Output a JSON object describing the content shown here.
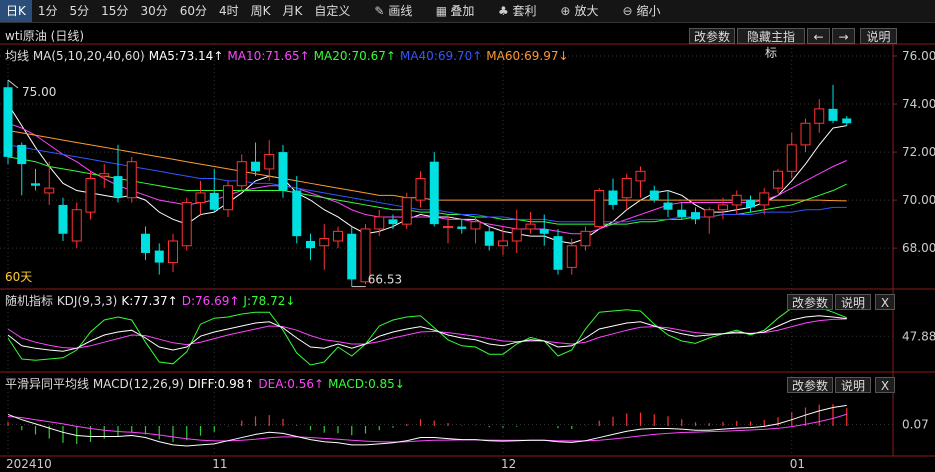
{
  "toolbar": {
    "items": [
      "日K",
      "1分",
      "5分",
      "15分",
      "30分",
      "60分",
      "4时",
      "周K",
      "月K",
      "自定义",
      "画线",
      "叠加",
      "套利",
      "放大",
      "缩小"
    ],
    "active": 0
  },
  "panel_buttons": {
    "main": [
      "改参数",
      "隐藏主指标",
      "←",
      "→",
      "说明"
    ],
    "kdj": [
      "改参数",
      "说明",
      "X"
    ],
    "macd": [
      "改参数",
      "说明",
      "X"
    ]
  },
  "main_title": "wti原油 (日线)",
  "ma_legend": {
    "prefix": "均线 MA(5,10,20,40,60)",
    "items": [
      {
        "text": "MA5:73.14↑",
        "color": "#ffffff"
      },
      {
        "text": "MA10:71.65↑",
        "color": "#ff44ff"
      },
      {
        "text": "MA20:70.67↑",
        "color": "#33ff33"
      },
      {
        "text": "MA40:69.70↑",
        "color": "#3355ff"
      },
      {
        "text": "MA60:69.97↓",
        "color": "#ff9933"
      }
    ]
  },
  "kdj_legend": {
    "prefix": "随机指标 KDJ(9,3,3)",
    "items": [
      {
        "text": "K:77.37↑",
        "color": "#ffffff"
      },
      {
        "text": "D:76.69↑",
        "color": "#ff44ff"
      },
      {
        "text": "J:78.72↓",
        "color": "#33ff33"
      }
    ]
  },
  "macd_legend": {
    "prefix": "平滑异同平均线 MACD(12,26,9)",
    "items": [
      {
        "text": "DIFF:0.98↑",
        "color": "#ffffff"
      },
      {
        "text": "DEA:0.56↑",
        "color": "#ff44ff"
      },
      {
        "text": "MACD:0.85↓",
        "color": "#33ff33"
      }
    ]
  },
  "annotations": {
    "high": "75.00",
    "low": "66.53",
    "period": "60天"
  },
  "chart_data": {
    "type": "candlestick",
    "title": "wti原油 (日线)",
    "x_ticks": [
      {
        "label": "202410",
        "index": 0
      },
      {
        "label": "11",
        "index": 15
      },
      {
        "label": "12",
        "index": 36
      },
      {
        "label": "01",
        "index": 57
      }
    ],
    "y_ticks": [
      68.0,
      70.0,
      72.0,
      74.0,
      76.0
    ],
    "ylim": [
      66.3,
      76.5
    ],
    "candles": [
      [
        74.7,
        75.0,
        71.5,
        71.8
      ],
      [
        72.3,
        72.4,
        70.2,
        71.5
      ],
      [
        70.7,
        71.3,
        70.4,
        70.6
      ],
      [
        70.3,
        71.6,
        69.8,
        70.5
      ],
      [
        69.8,
        70.1,
        68.3,
        68.6
      ],
      [
        68.3,
        69.9,
        68.0,
        69.6
      ],
      [
        69.5,
        71.2,
        69.2,
        70.9
      ],
      [
        71.0,
        71.5,
        70.5,
        71.1
      ],
      [
        71.0,
        72.3,
        69.9,
        70.1
      ],
      [
        70.1,
        71.8,
        69.9,
        71.6
      ],
      [
        68.6,
        68.9,
        67.5,
        67.8
      ],
      [
        67.9,
        68.2,
        66.9,
        67.4
      ],
      [
        67.4,
        68.6,
        67.0,
        68.3
      ],
      [
        68.1,
        70.1,
        67.9,
        69.9
      ],
      [
        69.9,
        70.8,
        69.4,
        70.3
      ],
      [
        70.3,
        71.3,
        69.5,
        69.6
      ],
      [
        69.6,
        70.8,
        69.3,
        70.6
      ],
      [
        70.6,
        71.9,
        70.4,
        71.6
      ],
      [
        71.6,
        72.4,
        71.0,
        71.2
      ],
      [
        71.3,
        72.5,
        70.8,
        71.9
      ],
      [
        72.0,
        72.3,
        70.1,
        70.4
      ],
      [
        70.4,
        71.0,
        68.2,
        68.5
      ],
      [
        68.3,
        68.6,
        67.5,
        68.0
      ],
      [
        68.1,
        69.0,
        67.1,
        68.4
      ],
      [
        68.3,
        68.9,
        68.0,
        68.7
      ],
      [
        68.6,
        68.9,
        66.4,
        66.7
      ],
      [
        66.6,
        69.0,
        66.5,
        68.8
      ],
      [
        68.8,
        69.6,
        68.5,
        69.3
      ],
      [
        69.2,
        69.4,
        68.8,
        69.0
      ],
      [
        69.0,
        70.3,
        68.8,
        70.1
      ],
      [
        70.0,
        71.2,
        69.7,
        70.9
      ],
      [
        71.6,
        72.0,
        68.9,
        69.0
      ],
      [
        68.9,
        69.4,
        68.2,
        68.9
      ],
      [
        68.9,
        69.2,
        68.6,
        68.8
      ],
      [
        68.8,
        69.3,
        68.2,
        69.1
      ],
      [
        68.7,
        68.9,
        67.9,
        68.1
      ],
      [
        68.1,
        68.9,
        67.7,
        68.3
      ],
      [
        68.3,
        69.6,
        67.8,
        68.8
      ],
      [
        68.8,
        69.5,
        68.6,
        69.0
      ],
      [
        68.8,
        69.4,
        68.1,
        68.6
      ],
      [
        68.5,
        68.8,
        66.9,
        67.1
      ],
      [
        67.2,
        68.4,
        66.9,
        68.1
      ],
      [
        68.1,
        68.9,
        67.9,
        68.7
      ],
      [
        68.9,
        70.5,
        68.8,
        70.4
      ],
      [
        70.4,
        70.9,
        69.6,
        69.8
      ],
      [
        70.1,
        71.1,
        69.6,
        70.9
      ],
      [
        70.8,
        71.4,
        70.1,
        71.2
      ],
      [
        70.4,
        70.6,
        69.9,
        70.0
      ],
      [
        69.9,
        70.4,
        69.3,
        69.6
      ],
      [
        69.6,
        69.9,
        69.2,
        69.3
      ],
      [
        69.5,
        69.7,
        69.0,
        69.2
      ],
      [
        69.3,
        69.7,
        68.6,
        69.6
      ],
      [
        69.6,
        70.1,
        69.2,
        69.8
      ],
      [
        69.8,
        70.4,
        69.4,
        70.2
      ],
      [
        70.0,
        70.2,
        69.5,
        69.7
      ],
      [
        69.8,
        70.5,
        69.4,
        70.3
      ],
      [
        70.5,
        71.3,
        70.3,
        71.2
      ],
      [
        71.2,
        72.8,
        70.9,
        72.3
      ],
      [
        72.3,
        73.4,
        72.0,
        73.2
      ],
      [
        73.2,
        74.2,
        72.8,
        73.8
      ],
      [
        73.8,
        74.8,
        73.2,
        73.3
      ],
      [
        73.4,
        73.5,
        73.1,
        73.2
      ]
    ],
    "ma": {
      "MA5": [
        74.0,
        73.1,
        72.2,
        71.4,
        70.7,
        70.4,
        70.3,
        70.2,
        70.1,
        70.2,
        70.0,
        69.5,
        69.2,
        69.0,
        69.4,
        69.5,
        69.9,
        70.3,
        70.8,
        71.0,
        70.9,
        70.3,
        70.0,
        69.6,
        69.3,
        68.9,
        68.6,
        68.7,
        68.9,
        69.2,
        69.4,
        69.3,
        69.3,
        69.2,
        69.2,
        68.9,
        68.7,
        68.6,
        68.5,
        68.5,
        68.3,
        68.2,
        68.4,
        68.8,
        69.1,
        69.6,
        70.0,
        70.3,
        70.4,
        70.2,
        69.8,
        69.5,
        69.5,
        69.6,
        69.7,
        69.9,
        70.2,
        70.8,
        71.5,
        72.3,
        73.0,
        73.1
      ],
      "MA10": [
        73.2,
        73.0,
        72.7,
        72.3,
        71.9,
        71.6,
        71.2,
        70.9,
        70.6,
        70.4,
        70.2,
        70.0,
        69.9,
        69.8,
        69.9,
        70.0,
        70.2,
        70.4,
        70.5,
        70.6,
        70.6,
        70.5,
        70.3,
        70.1,
        69.9,
        69.6,
        69.4,
        69.3,
        69.3,
        69.3,
        69.3,
        69.3,
        69.2,
        69.2,
        69.1,
        69.0,
        68.9,
        68.8,
        68.8,
        68.8,
        68.7,
        68.6,
        68.6,
        68.8,
        69.0,
        69.2,
        69.4,
        69.6,
        69.8,
        69.9,
        69.9,
        69.9,
        69.9,
        69.9,
        69.9,
        70.0,
        70.2,
        70.5,
        70.8,
        71.1,
        71.4,
        71.65
      ],
      "MA20": [
        71.8,
        71.7,
        71.6,
        71.4,
        71.3,
        71.2,
        71.1,
        71.0,
        70.9,
        70.8,
        70.7,
        70.6,
        70.5,
        70.4,
        70.4,
        70.4,
        70.4,
        70.4,
        70.4,
        70.4,
        70.4,
        70.3,
        70.2,
        70.1,
        70.0,
        69.9,
        69.8,
        69.7,
        69.6,
        69.6,
        69.5,
        69.5,
        69.4,
        69.4,
        69.3,
        69.3,
        69.2,
        69.2,
        69.1,
        69.1,
        69.0,
        69.0,
        69.0,
        69.0,
        69.0,
        69.0,
        69.1,
        69.1,
        69.2,
        69.2,
        69.3,
        69.3,
        69.4,
        69.4,
        69.5,
        69.6,
        69.7,
        69.8,
        70.0,
        70.2,
        70.4,
        70.67
      ],
      "MA40": [
        72.3,
        72.2,
        72.1,
        72.0,
        71.9,
        71.8,
        71.7,
        71.6,
        71.5,
        71.4,
        71.3,
        71.2,
        71.1,
        71.0,
        70.9,
        70.9,
        70.8,
        70.8,
        70.7,
        70.7,
        70.6,
        70.5,
        70.4,
        70.3,
        70.2,
        70.1,
        70.0,
        69.9,
        69.8,
        69.7,
        69.6,
        69.6,
        69.5,
        69.4,
        69.4,
        69.3,
        69.3,
        69.2,
        69.2,
        69.2,
        69.1,
        69.1,
        69.1,
        69.1,
        69.1,
        69.1,
        69.2,
        69.2,
        69.2,
        69.3,
        69.3,
        69.3,
        69.4,
        69.4,
        69.4,
        69.5,
        69.5,
        69.5,
        69.6,
        69.6,
        69.7,
        69.7
      ],
      "MA60": [
        72.9,
        72.8,
        72.7,
        72.6,
        72.5,
        72.4,
        72.3,
        72.2,
        72.1,
        72.0,
        71.9,
        71.8,
        71.7,
        71.6,
        71.5,
        71.4,
        71.3,
        71.2,
        71.1,
        71.0,
        70.9,
        70.8,
        70.7,
        70.6,
        70.5,
        70.4,
        70.3,
        70.2,
        70.2,
        70.1,
        70.1,
        70.0,
        70.0,
        70.0,
        70.0,
        70.0,
        70.0,
        70.0,
        70.0,
        70.0,
        70.0,
        70.0,
        70.0,
        70.0,
        70.0,
        70.0,
        70.0,
        70.0,
        70.0,
        70.0,
        70.0,
        70.0,
        70.0,
        70.0,
        70.0,
        70.0,
        70.0,
        70.0,
        70.0,
        70.0,
        69.98,
        69.97
      ]
    },
    "kdj": {
      "y_tick": "47.88",
      "ylim": [
        0,
        100
      ],
      "K": [
        50,
        32,
        28,
        25,
        23,
        28,
        40,
        50,
        55,
        58,
        45,
        30,
        25,
        30,
        48,
        55,
        60,
        65,
        70,
        72,
        62,
        45,
        30,
        28,
        35,
        28,
        35,
        48,
        55,
        60,
        64,
        58,
        50,
        45,
        42,
        35,
        32,
        38,
        42,
        40,
        30,
        32,
        45,
        60,
        65,
        70,
        72,
        65,
        58,
        52,
        48,
        50,
        52,
        55,
        52,
        55,
        65,
        75,
        80,
        82,
        80,
        77.37
      ],
      "D": [
        60,
        45,
        38,
        33,
        29,
        28,
        32,
        38,
        44,
        50,
        49,
        43,
        37,
        34,
        38,
        44,
        50,
        55,
        60,
        65,
        64,
        58,
        49,
        42,
        39,
        35,
        35,
        39,
        45,
        50,
        55,
        56,
        54,
        51,
        48,
        44,
        40,
        39,
        40,
        40,
        37,
        35,
        38,
        46,
        52,
        58,
        63,
        64,
        62,
        58,
        54,
        52,
        52,
        53,
        53,
        54,
        58,
        64,
        70,
        74,
        76,
        76.69
      ],
      "J": [
        45,
        10,
        8,
        10,
        12,
        25,
        55,
        75,
        80,
        75,
        38,
        5,
        2,
        22,
        68,
        78,
        80,
        85,
        88,
        88,
        58,
        20,
        0,
        5,
        30,
        15,
        35,
        65,
        75,
        80,
        82,
        62,
        42,
        32,
        30,
        18,
        18,
        35,
        46,
        40,
        15,
        25,
        60,
        88,
        90,
        92,
        90,
        68,
        50,
        40,
        36,
        45,
        52,
        58,
        50,
        58,
        78,
        95,
        98,
        96,
        88,
        78.72
      ]
    },
    "macd": {
      "y_tick": "0.07",
      "DIFF": [
        0.55,
        0.3,
        0.1,
        -0.1,
        -0.3,
        -0.45,
        -0.5,
        -0.5,
        -0.5,
        -0.45,
        -0.55,
        -0.75,
        -0.9,
        -0.95,
        -0.9,
        -0.85,
        -0.7,
        -0.55,
        -0.4,
        -0.3,
        -0.35,
        -0.5,
        -0.65,
        -0.75,
        -0.8,
        -0.9,
        -0.9,
        -0.85,
        -0.8,
        -0.7,
        -0.55,
        -0.55,
        -0.6,
        -0.65,
        -0.65,
        -0.7,
        -0.72,
        -0.7,
        -0.68,
        -0.68,
        -0.75,
        -0.78,
        -0.7,
        -0.55,
        -0.4,
        -0.25,
        -0.15,
        -0.12,
        -0.12,
        -0.15,
        -0.2,
        -0.2,
        -0.15,
        -0.1,
        -0.08,
        -0.02,
        0.1,
        0.3,
        0.52,
        0.72,
        0.88,
        0.98
      ],
      "DEA": [
        0.45,
        0.4,
        0.3,
        0.2,
        0.1,
        -0.02,
        -0.12,
        -0.2,
        -0.26,
        -0.3,
        -0.35,
        -0.43,
        -0.52,
        -0.61,
        -0.67,
        -0.71,
        -0.71,
        -0.68,
        -0.63,
        -0.56,
        -0.52,
        -0.52,
        -0.55,
        -0.59,
        -0.63,
        -0.68,
        -0.72,
        -0.75,
        -0.76,
        -0.75,
        -0.71,
        -0.68,
        -0.67,
        -0.66,
        -0.66,
        -0.67,
        -0.68,
        -0.68,
        -0.68,
        -0.68,
        -0.7,
        -0.71,
        -0.71,
        -0.68,
        -0.62,
        -0.55,
        -0.47,
        -0.4,
        -0.35,
        -0.31,
        -0.29,
        -0.27,
        -0.25,
        -0.22,
        -0.19,
        -0.16,
        -0.11,
        -0.03,
        0.08,
        0.21,
        0.36,
        0.56
      ],
      "MACD": [
        0.2,
        -0.2,
        -0.4,
        -0.6,
        -0.8,
        -0.86,
        -0.76,
        -0.6,
        -0.48,
        -0.3,
        -0.4,
        -0.64,
        -0.76,
        -0.68,
        -0.46,
        -0.28,
        -0.02,
        0.26,
        0.46,
        0.52,
        0.34,
        0.04,
        -0.2,
        -0.32,
        -0.34,
        -0.44,
        -0.36,
        -0.2,
        -0.08,
        0.1,
        0.32,
        0.26,
        0.14,
        0.02,
        0.02,
        -0.06,
        -0.08,
        -0.04,
        0.0,
        0.0,
        -0.1,
        -0.14,
        0.02,
        0.26,
        0.44,
        0.6,
        0.64,
        0.56,
        0.46,
        0.32,
        0.18,
        0.14,
        0.2,
        0.24,
        0.22,
        0.28,
        0.42,
        0.66,
        0.88,
        1.02,
        1.04,
        0.85
      ]
    }
  }
}
